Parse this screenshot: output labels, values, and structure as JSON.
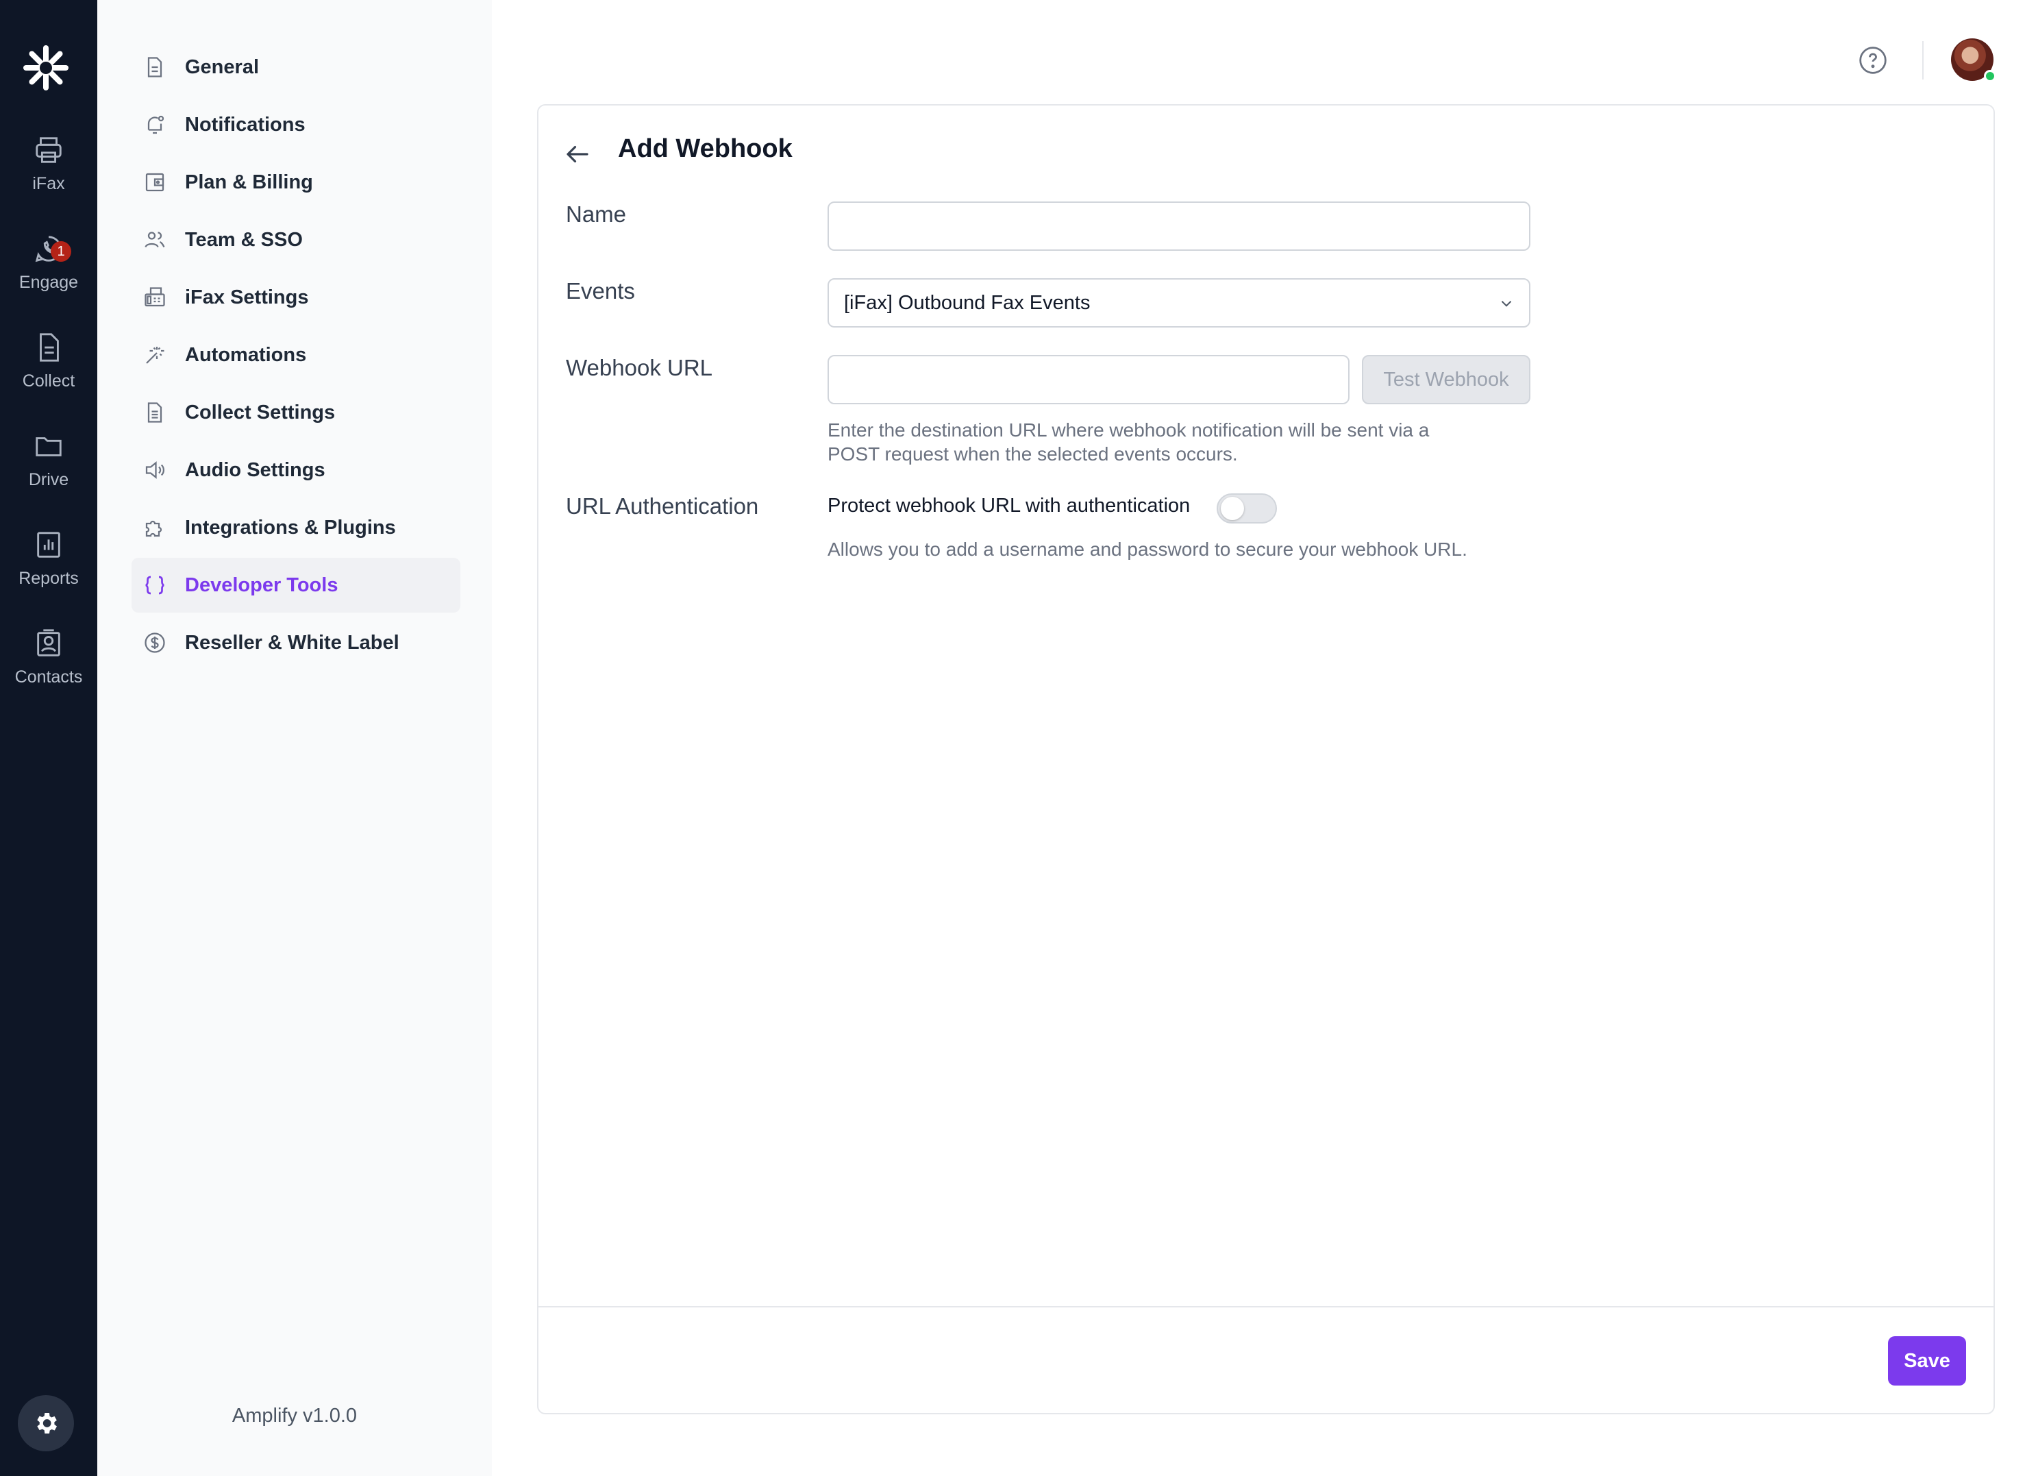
{
  "rail": {
    "logo_icon": "asterisk-logo-icon",
    "items": [
      {
        "label": "iFax",
        "icon": "printer-icon"
      },
      {
        "label": "Engage",
        "icon": "phone-chat-icon",
        "badge": "1"
      },
      {
        "label": "Collect",
        "icon": "document-icon"
      },
      {
        "label": "Drive",
        "icon": "folder-icon"
      },
      {
        "label": "Reports",
        "icon": "bar-chart-icon"
      },
      {
        "label": "Contacts",
        "icon": "contact-card-icon"
      }
    ],
    "settings_icon": "gear-icon"
  },
  "sidebar": {
    "items": [
      {
        "label": "General",
        "icon": "file-icon"
      },
      {
        "label": "Notifications",
        "icon": "bell-icon"
      },
      {
        "label": "Plan & Billing",
        "icon": "wallet-icon"
      },
      {
        "label": "Team & SSO",
        "icon": "users-icon"
      },
      {
        "label": "iFax Settings",
        "icon": "fax-machine-icon"
      },
      {
        "label": "Automations",
        "icon": "magic-wand-icon"
      },
      {
        "label": "Collect Settings",
        "icon": "file-text-icon"
      },
      {
        "label": "Audio Settings",
        "icon": "speaker-icon"
      },
      {
        "label": "Integrations & Plugins",
        "icon": "puzzle-icon"
      },
      {
        "label": "Developer Tools",
        "icon": "code-braces-icon",
        "active": true
      },
      {
        "label": "Reseller & White Label",
        "icon": "dollar-circle-icon"
      }
    ],
    "version": "Amplify v1.0.0"
  },
  "header": {
    "help_icon": "question-circle-icon"
  },
  "form": {
    "title": "Add Webhook",
    "name_label": "Name",
    "name_value": "",
    "events_label": "Events",
    "events_value": "[iFax] Outbound Fax Events",
    "url_label": "Webhook URL",
    "url_value": "",
    "test_button": "Test Webhook",
    "url_help_line1": "Enter the destination URL where webhook notification will be sent via a",
    "url_help_line2": "POST request when the selected events occurs.",
    "auth_label": "URL Authentication",
    "auth_toggle_label": "Protect webhook URL with authentication",
    "auth_enabled": false,
    "auth_help": "Allows you to add a username and password to secure your webhook URL.",
    "save_button": "Save"
  },
  "colors": {
    "accent": "#7c3aed",
    "rail_bg": "#0e1626",
    "sidebar_bg": "#f9fafb",
    "badge": "#b42318"
  }
}
